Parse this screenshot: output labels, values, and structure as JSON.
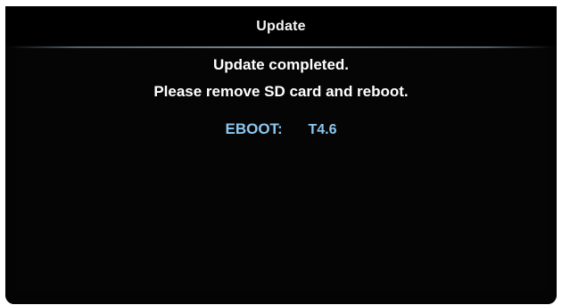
{
  "header": {
    "title": "Update"
  },
  "message": {
    "line1": "Update completed.",
    "line2": "Please remove SD card and reboot."
  },
  "version": {
    "label": "EBOOT:",
    "value": "T4.6"
  },
  "colors": {
    "background": "#050505",
    "text": "#ffffff",
    "version_text": "#8cc8f0",
    "divider": "#9fb9cc"
  }
}
